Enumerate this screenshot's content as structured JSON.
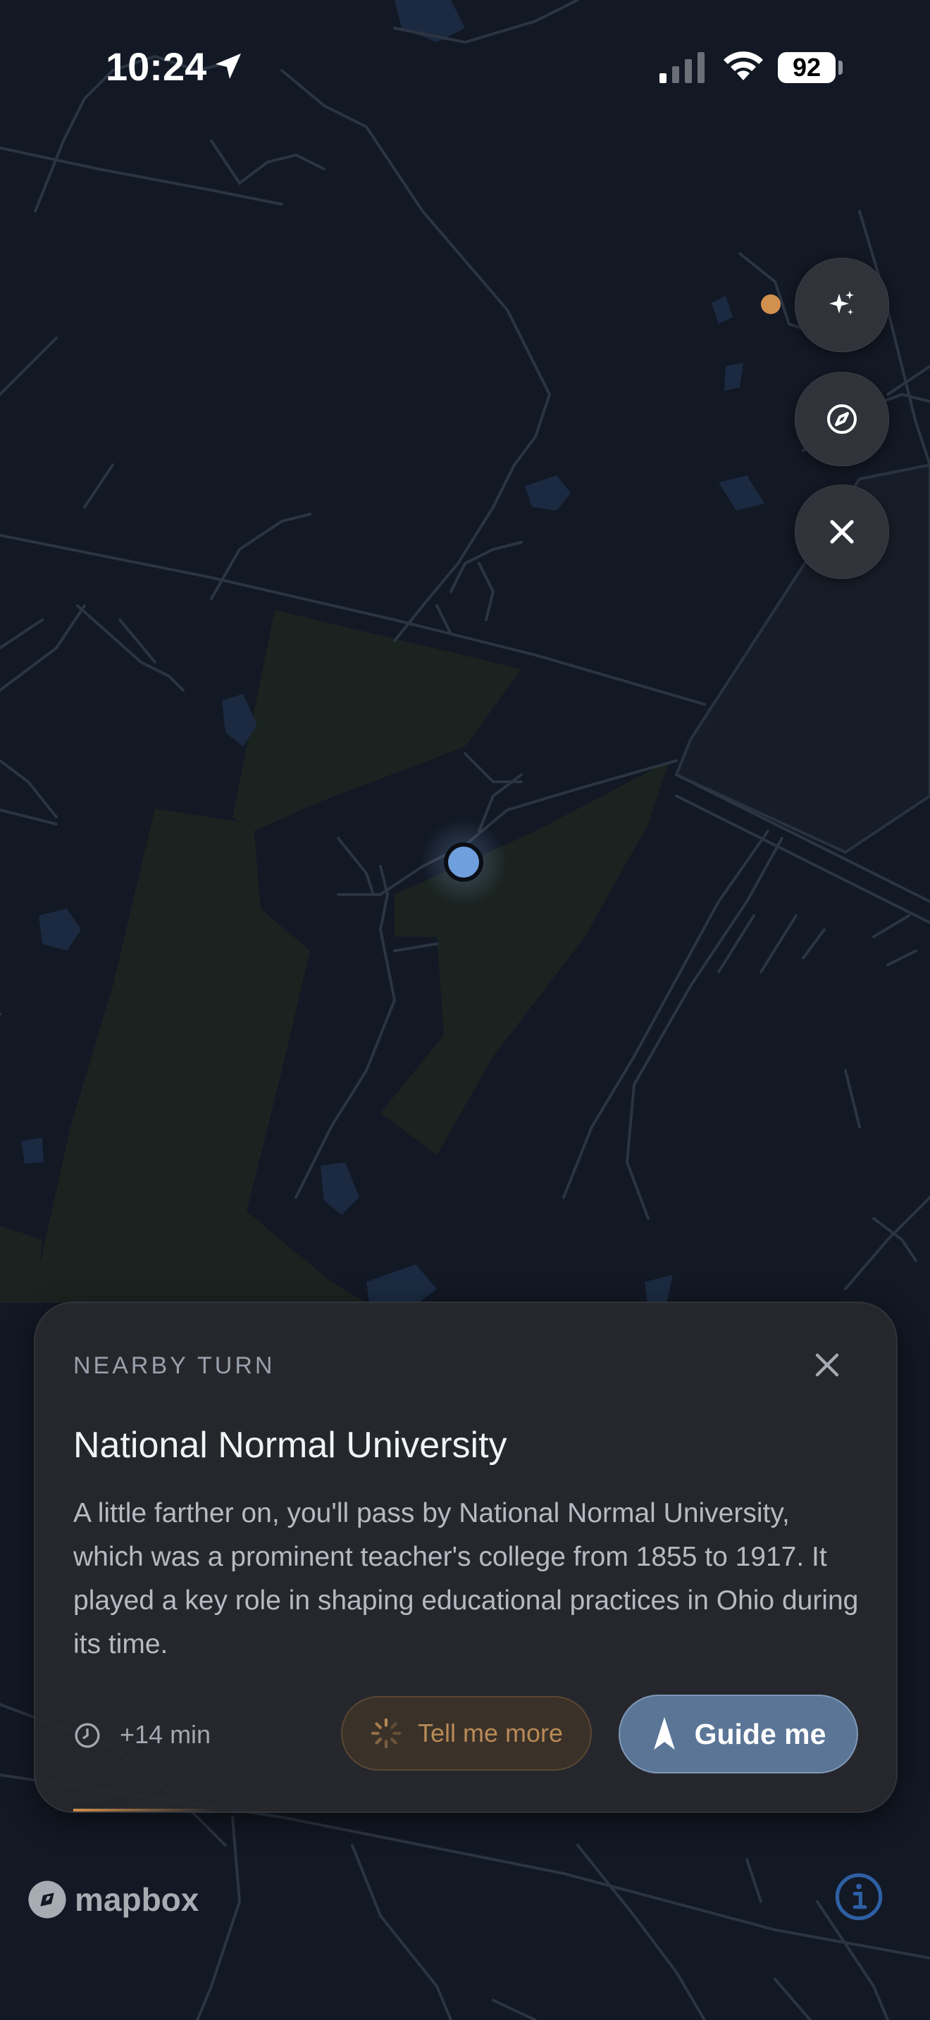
{
  "status_bar": {
    "time": "10:24",
    "battery": "92",
    "icons": [
      "location-arrow-icon",
      "cellular-signal-icon",
      "wifi-icon",
      "battery-icon"
    ]
  },
  "controls": {
    "icons": [
      "sparkles-icon",
      "compass-icon",
      "close-icon"
    ],
    "has_notification": true
  },
  "card": {
    "kicker": "NEARBY TURN",
    "title": "National Normal University",
    "body": "A little farther on, you'll pass by National Normal University, which was a prominent teacher's college from 1855 to 1917. It played a key role in shaping educational practices in Ohio during its time.",
    "eta": "+14 min",
    "secondary_button": "Tell me more",
    "primary_button": "Guide me"
  },
  "attribution": {
    "logo_text": "mapbox",
    "info_icon": "info-icon"
  },
  "colors": {
    "background": "#121824",
    "accent_orange": "#d1904e",
    "primary_button": "#5b7596",
    "user_location": "#6f9fdc",
    "park": "#1b2320"
  }
}
